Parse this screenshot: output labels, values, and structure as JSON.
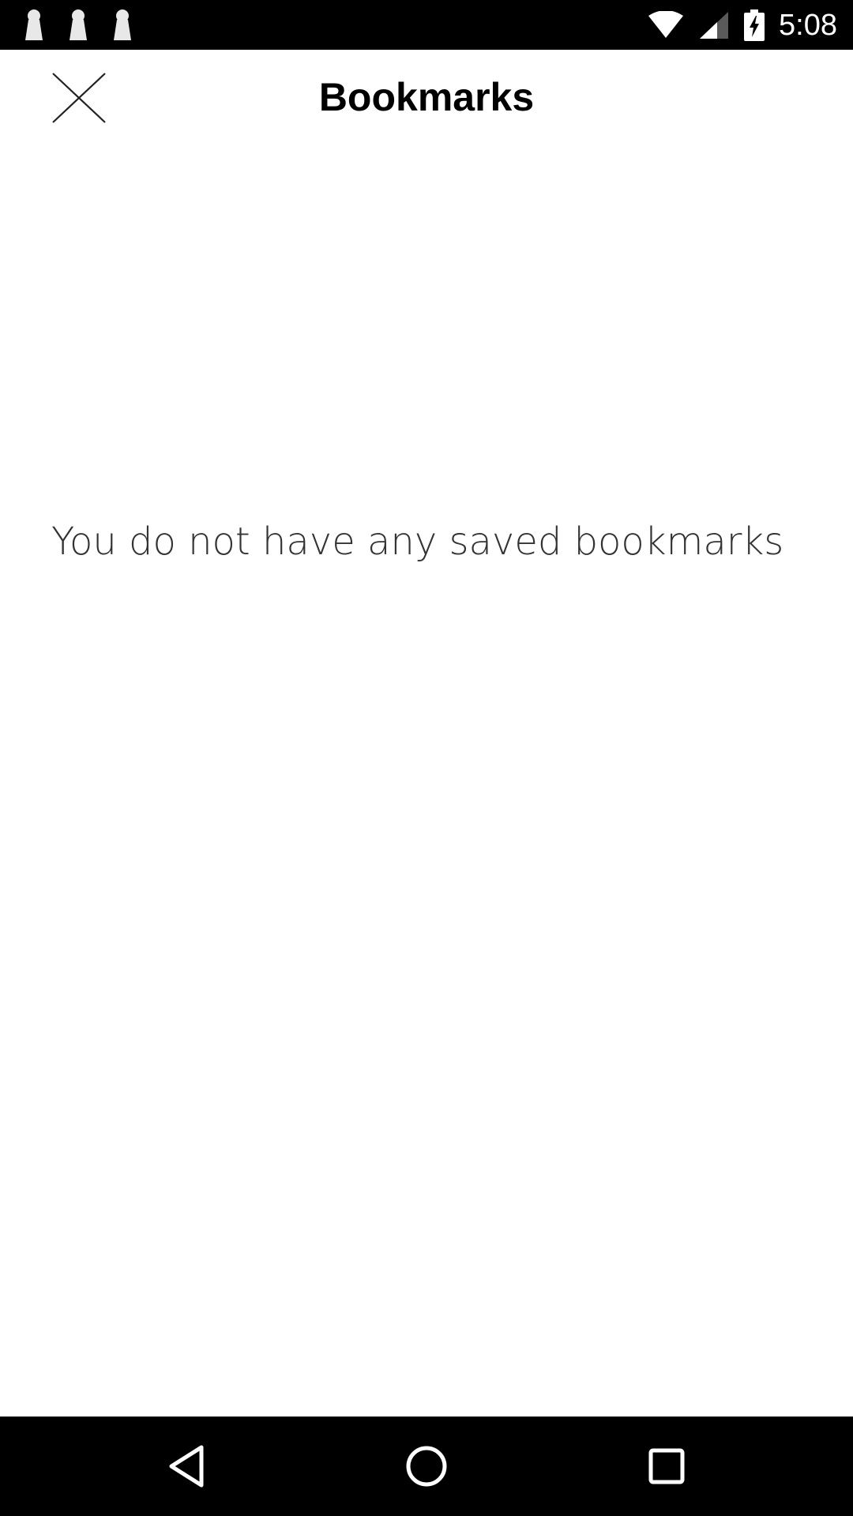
{
  "status_bar": {
    "time": "5:08",
    "notification_icons": [
      "keyhole-icon",
      "keyhole-icon",
      "keyhole-icon"
    ],
    "right_icons": [
      "wifi-icon",
      "cell-signal-icon",
      "battery-charging-icon"
    ]
  },
  "app_bar": {
    "title": "Bookmarks",
    "close_icon": "close-icon"
  },
  "content": {
    "empty_message": "You do not have any saved bookmarks"
  },
  "nav_bar": {
    "buttons": [
      "back-icon",
      "home-icon",
      "recents-icon"
    ]
  },
  "colors": {
    "background": "#ffffff",
    "bars": "#000000",
    "title_text": "#000000",
    "message_text": "#333333"
  }
}
